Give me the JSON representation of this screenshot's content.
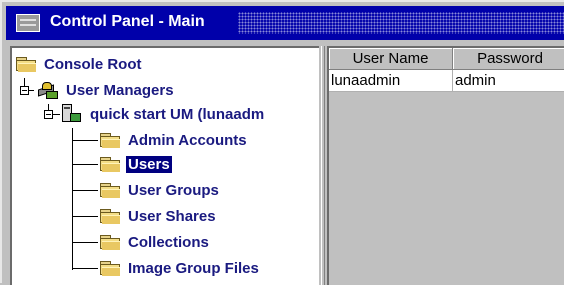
{
  "window": {
    "title": "Control Panel - Main"
  },
  "tree": {
    "root_label": "Console Root",
    "user_managers_label": "User Managers",
    "um_instance_label": "quick start UM (lunaadm",
    "children": [
      {
        "label": "Admin Accounts",
        "selected": false
      },
      {
        "label": "Users",
        "selected": true
      },
      {
        "label": "User Groups",
        "selected": false
      },
      {
        "label": "User Shares",
        "selected": false
      },
      {
        "label": "Collections",
        "selected": false
      },
      {
        "label": "Image Group Files",
        "selected": false
      }
    ]
  },
  "table": {
    "columns": [
      "User Name",
      "Password"
    ],
    "rows": [
      [
        "lunaadmin",
        "admin"
      ]
    ]
  },
  "colors": {
    "title_bar": "#0000aa",
    "tree_text": "#1a1a80",
    "selection": "#000080"
  }
}
